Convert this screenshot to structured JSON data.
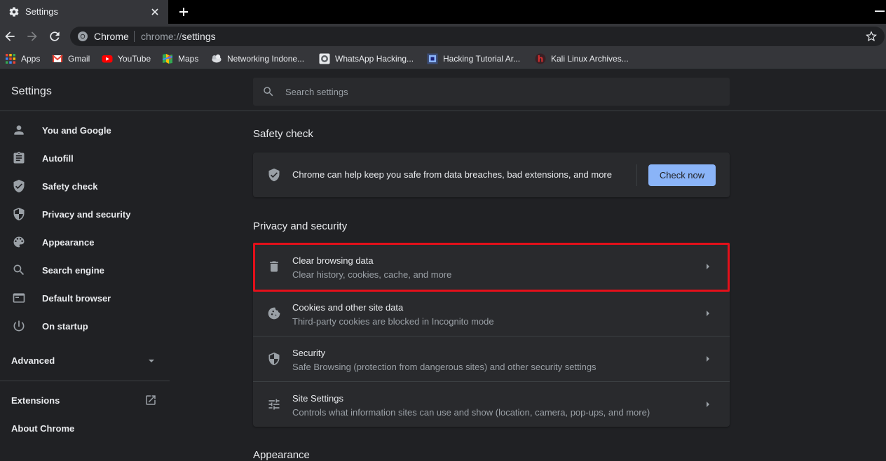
{
  "browser": {
    "tab_title": "Settings",
    "omnibox_site": "Chrome",
    "omnibox_url_prefix": "chrome://",
    "omnibox_url_path": "settings"
  },
  "bookmarks": [
    {
      "label": "Apps",
      "icon": "apps-grid-icon"
    },
    {
      "label": "Gmail",
      "icon": "gmail-icon"
    },
    {
      "label": "YouTube",
      "icon": "youtube-icon"
    },
    {
      "label": "Maps",
      "icon": "maps-icon"
    },
    {
      "label": "Networking Indone...",
      "icon": "site-icon"
    },
    {
      "label": "WhatsApp Hacking...",
      "icon": "site-icon"
    },
    {
      "label": "Hacking Tutorial Ar...",
      "icon": "site-icon"
    },
    {
      "label": "Kali Linux Archives...",
      "icon": "site-icon"
    }
  ],
  "header": {
    "title": "Settings",
    "search_placeholder": "Search settings"
  },
  "sidebar": {
    "items": [
      {
        "label": "You and Google",
        "icon": "person-icon"
      },
      {
        "label": "Autofill",
        "icon": "clipboard-icon"
      },
      {
        "label": "Safety check",
        "icon": "shield-check-icon"
      },
      {
        "label": "Privacy and security",
        "icon": "shield-half-icon"
      },
      {
        "label": "Appearance",
        "icon": "palette-icon"
      },
      {
        "label": "Search engine",
        "icon": "search-icon"
      },
      {
        "label": "Default browser",
        "icon": "browser-window-icon"
      },
      {
        "label": "On startup",
        "icon": "power-icon"
      }
    ],
    "advanced": "Advanced",
    "extensions": "Extensions",
    "about": "About Chrome"
  },
  "safety_check": {
    "title": "Safety check",
    "text": "Chrome can help keep you safe from data breaches, bad extensions, and more",
    "button": "Check now"
  },
  "privacy": {
    "title": "Privacy and security",
    "rows": [
      {
        "title": "Clear browsing data",
        "subtitle": "Clear history, cookies, cache, and more",
        "icon": "trash-icon"
      },
      {
        "title": "Cookies and other site data",
        "subtitle": "Third-party cookies are blocked in Incognito mode",
        "icon": "cookie-icon"
      },
      {
        "title": "Security",
        "subtitle": "Safe Browsing (protection from dangerous sites) and other security settings",
        "icon": "shield-half-icon"
      },
      {
        "title": "Site Settings",
        "subtitle": "Controls what information sites can use and show (location, camera, pop-ups, and more)",
        "icon": "sliders-icon"
      }
    ]
  },
  "appearance_title": "Appearance",
  "colors": {
    "accent": "#8ab4f8",
    "highlight": "#e3101a",
    "background": "#202124",
    "card": "#292a2d"
  }
}
